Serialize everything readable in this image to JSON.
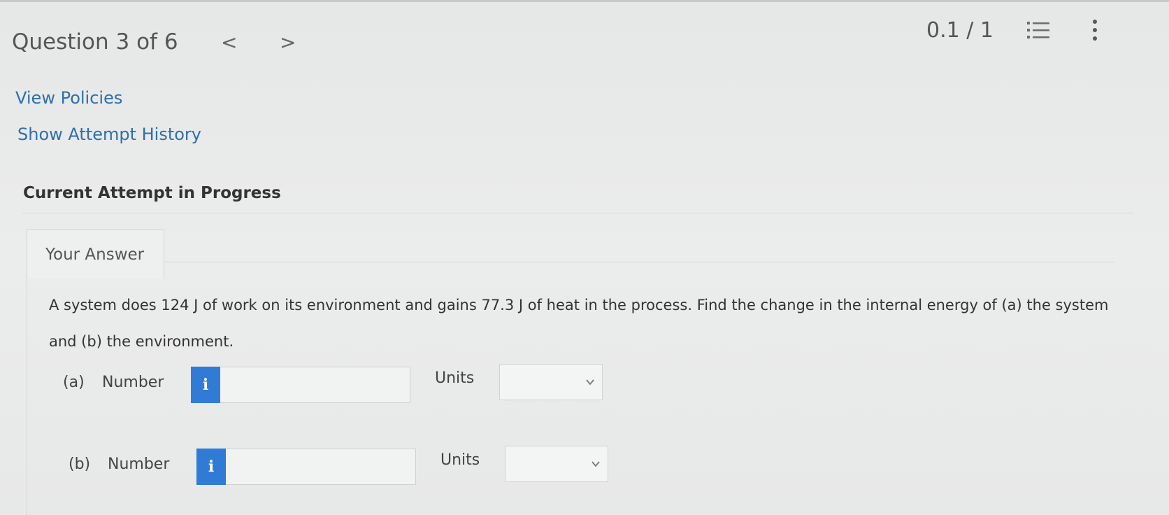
{
  "header": {
    "question_title": "Question 3 of 6",
    "prev_label": "<",
    "next_label": ">",
    "score": "0.1 / 1",
    "icons": [
      "list-icon",
      "kebab-menu-icon"
    ]
  },
  "links": {
    "view_policies": "View Policies",
    "show_attempt_history": "Show Attempt History"
  },
  "attempt": {
    "heading": "Current Attempt in Progress",
    "tab_label": "Your Answer"
  },
  "question": {
    "text": "A system does 124 J of work on its environment and gains 77.3 J of heat in the process. Find the change in the internal energy of (a) the system and (b) the environment."
  },
  "parts": {
    "a": {
      "label": "(a)",
      "number_label": "Number",
      "info_label": "i",
      "value": "",
      "units_label": "Units",
      "units_selected": ""
    },
    "b": {
      "label": "(b)",
      "number_label": "Number",
      "info_label": "i",
      "value": "",
      "units_label": "Units",
      "units_selected": ""
    }
  },
  "colors": {
    "link": "#2f6fa8",
    "info_button": "#2f7bd6",
    "background": "#e9eaea"
  }
}
